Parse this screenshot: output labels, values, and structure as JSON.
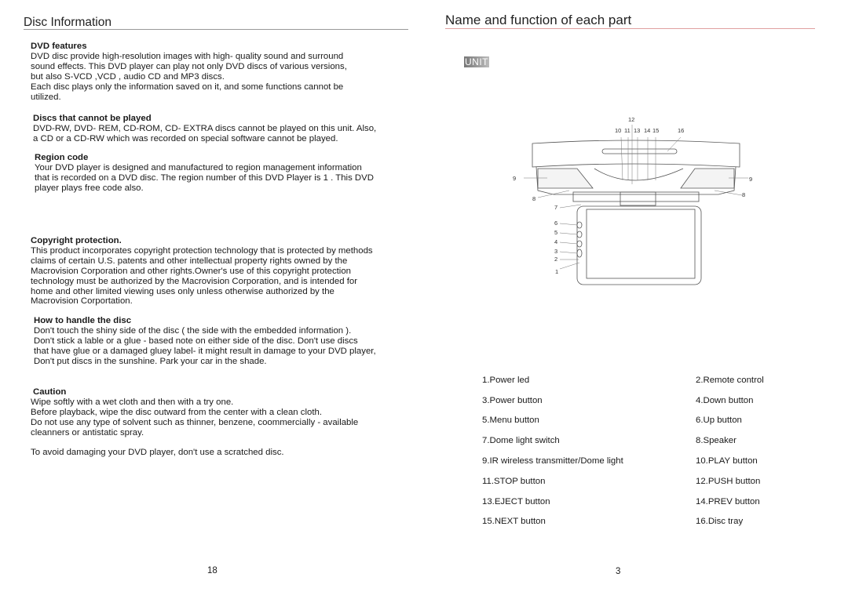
{
  "left": {
    "title": "Disc Information",
    "sections": [
      {
        "heading": "DVD features",
        "lines": [
          "DVD disc provide high-resolution images with high- quality sound and surround",
          "sound effects. This DVD player can play not only DVD discs of various versions,",
          "but also S-VCD ,VCD , audio CD and MP3 discs.",
          "Each disc plays only the information saved on it, and some functions cannot be",
          "utilized."
        ]
      },
      {
        "heading": "Discs that cannot be played",
        "lines": [
          "DVD-RW, DVD- REM, CD-ROM, CD- EXTRA discs cannot be played on this unit. Also,",
          "a CD or a CD-RW which was recorded on special software cannot be played."
        ]
      },
      {
        "heading": "Region code",
        "lines": [
          "Your DVD player is designed and manufactured to region management information",
          "that is recorded on a DVD disc. The region number of this DVD Player is 1 . This DVD",
          "player plays free code also."
        ]
      },
      {
        "heading": "Copyright protection.",
        "lines": [
          "This product incorporates copyright protection technology that is protected by methods",
          "claims of certain U.S. patents and other intellectual property rights owned by the",
          "Macrovision Corporation and other rights.Owner's use of this copyright protection",
          "technology must be authorized by the Macrovision Corporation, and is intended for",
          "home and other limited viewing uses only unless otherwise authorized by the",
          "Macrovision Corportation."
        ]
      },
      {
        "heading": "How to handle the disc",
        "lines": [
          "Don't touch the shiny side of the disc ( the side with the embedded information ).",
          "Don't stick a lable or a glue - based note on either side of the disc. Don't use discs",
          "that have glue or a damaged gluey label- it might result in damage to your DVD player,",
          "Don't put discs in the sunshine. Park your car in the shade."
        ]
      },
      {
        "heading": "Caution",
        "lines": [
          "Wipe softly with a wet cloth and then with a try one.",
          "Before playback, wipe the disc outward from the center with a clean cloth.",
          "Do not use any type of solvent such as thinner, benzene, coommercially - available",
          "cleanners or antistatic spray.",
          "",
          "To avoid damaging your DVD player, don't use a scratched disc."
        ]
      }
    ],
    "page_number": "18"
  },
  "right": {
    "title": "Name and function of each part",
    "unit_label": "UNIT",
    "callouts": [
      "1",
      "2",
      "3",
      "4",
      "5",
      "6",
      "7",
      "8",
      "9",
      "10",
      "11",
      "12",
      "13",
      "14",
      "15",
      "16"
    ],
    "parts": [
      [
        "1.Power led",
        "2.Remote control"
      ],
      [
        "3.Power button",
        "4.Down button"
      ],
      [
        "5.Menu button",
        "6.Up button"
      ],
      [
        "7.Dome light switch",
        "8.Speaker"
      ],
      [
        "9.IR wireless transmitter/Dome light",
        "10.PLAY button"
      ],
      [
        "11.STOP button",
        "12.PUSH button"
      ],
      [
        "13.EJECT button",
        "14.PREV button"
      ],
      [
        "15.NEXT button",
        "16.Disc tray"
      ]
    ],
    "page_number": "3"
  },
  "colors": {
    "left_rule": "#999999",
    "right_rule": "#e0a0a0"
  }
}
